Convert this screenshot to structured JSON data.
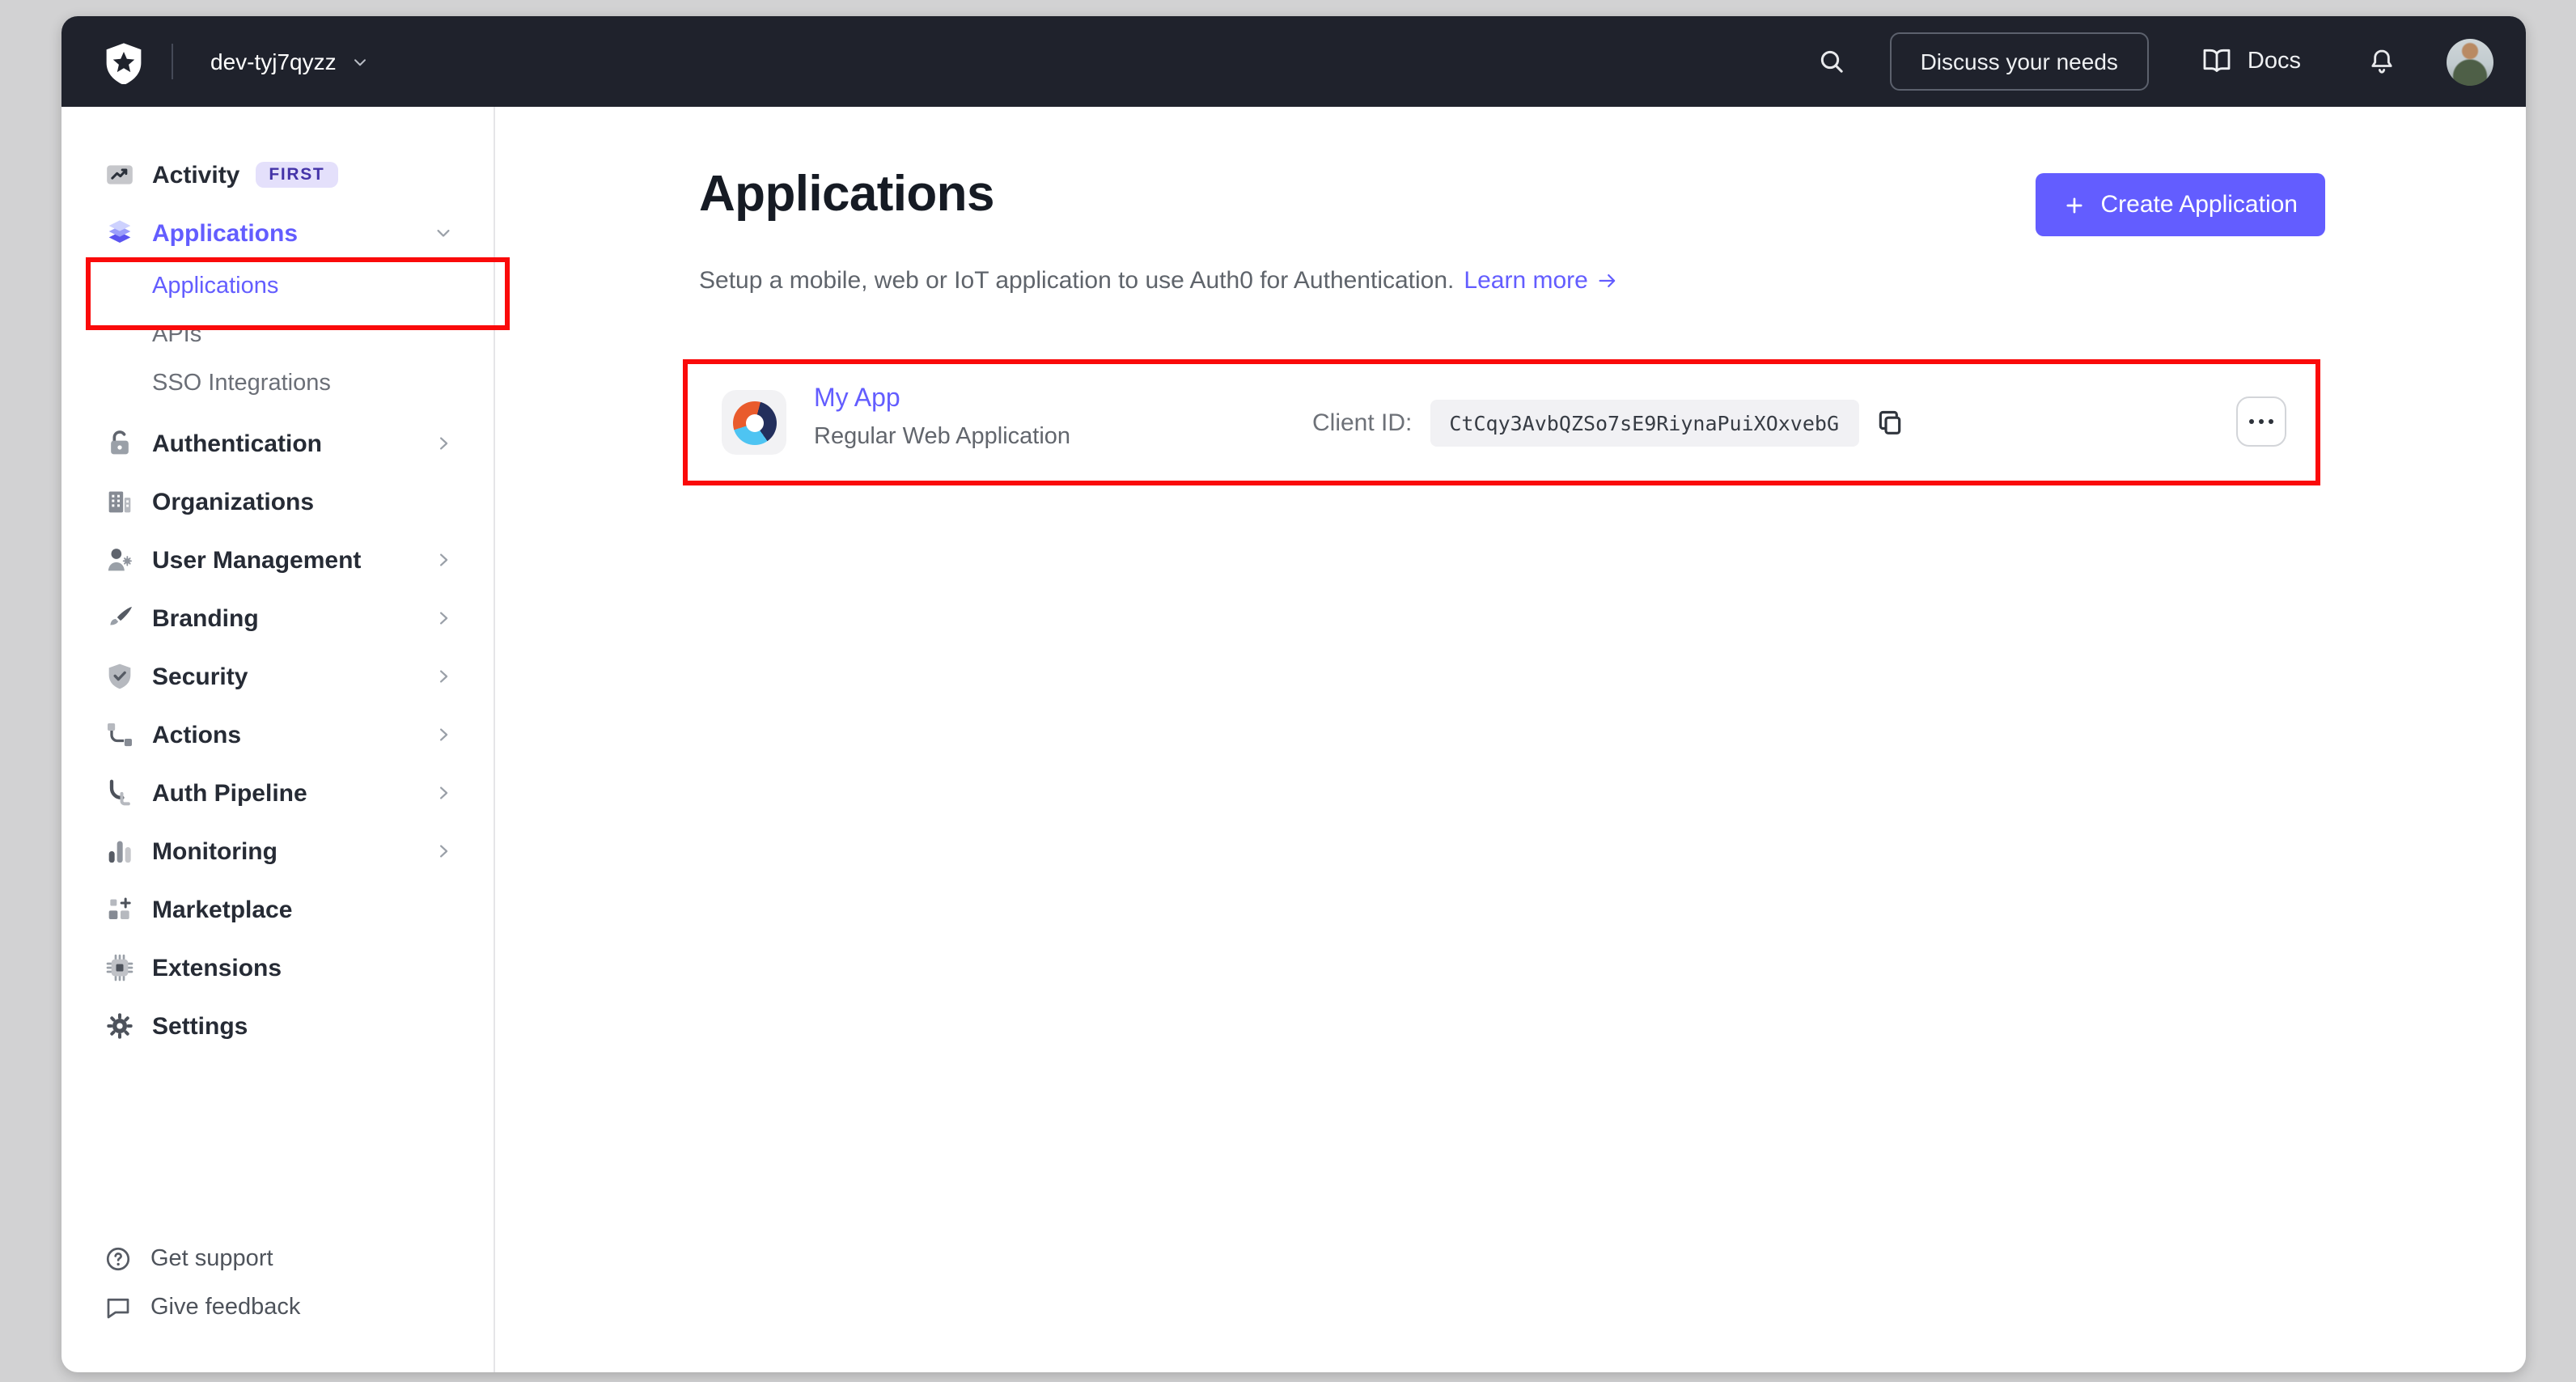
{
  "topbar": {
    "tenant": "dev-tyj7qyzz",
    "discuss_button": "Discuss your needs",
    "docs_label": "Docs"
  },
  "sidebar": {
    "items": [
      {
        "label": "Activity",
        "icon": "activity-icon",
        "type": "main",
        "badge": "FIRST"
      },
      {
        "label": "Applications",
        "icon": "layers-icon",
        "type": "main",
        "active": true,
        "chevron": "down"
      },
      {
        "label": "Applications",
        "type": "sub",
        "active": true
      },
      {
        "label": "APIs",
        "type": "sub"
      },
      {
        "label": "SSO Integrations",
        "type": "sub"
      },
      {
        "label": "Authentication",
        "icon": "lock-icon",
        "type": "main",
        "chevron": "right"
      },
      {
        "label": "Organizations",
        "icon": "building-icon",
        "type": "main"
      },
      {
        "label": "User Management",
        "icon": "user-gear-icon",
        "type": "main",
        "chevron": "right"
      },
      {
        "label": "Branding",
        "icon": "paintbrush-icon",
        "type": "main",
        "chevron": "right"
      },
      {
        "label": "Security",
        "icon": "shield-check-icon",
        "type": "main",
        "chevron": "right"
      },
      {
        "label": "Actions",
        "icon": "flow-icon",
        "type": "main",
        "chevron": "right"
      },
      {
        "label": "Auth Pipeline",
        "icon": "pipeline-icon",
        "type": "main",
        "chevron": "right"
      },
      {
        "label": "Monitoring",
        "icon": "bar-chart-icon",
        "type": "main",
        "chevron": "right"
      },
      {
        "label": "Marketplace",
        "icon": "grid-plus-icon",
        "type": "main"
      },
      {
        "label": "Extensions",
        "icon": "chip-icon",
        "type": "main"
      },
      {
        "label": "Settings",
        "icon": "gear-icon",
        "type": "main"
      }
    ],
    "footer_items": [
      {
        "label": "Get support",
        "icon": "help-circle-icon"
      },
      {
        "label": "Give feedback",
        "icon": "chat-bubble-icon"
      }
    ]
  },
  "main": {
    "title": "Applications",
    "create_button": "Create Application",
    "subtitle": "Setup a mobile, web or IoT application to use Auth0 for Authentication.",
    "learn_more": "Learn more",
    "app_card": {
      "name": "My App",
      "type": "Regular Web Application",
      "client_id_label": "Client ID:",
      "client_id": "CtCqy3AvbQZSo7sE9RiynaPuiXOxvebG"
    }
  },
  "colors": {
    "accent": "#635dff",
    "annotation_red": "#fa0a0a",
    "topbar_bg": "#1f222c",
    "badge_bg": "#e4e0fb",
    "badge_text": "#4433a8"
  }
}
